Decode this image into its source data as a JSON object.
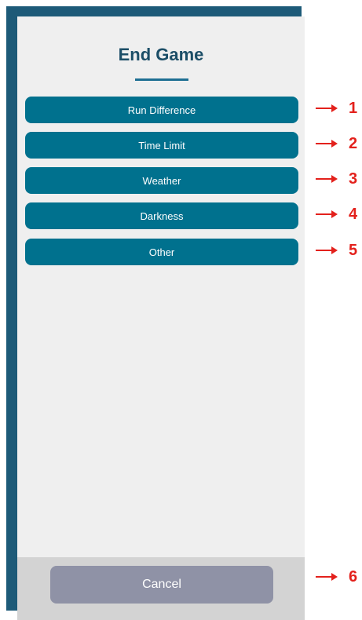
{
  "dialog": {
    "title": "End Game",
    "options": [
      {
        "label": "Run Difference"
      },
      {
        "label": "Time Limit"
      },
      {
        "label": "Weather"
      },
      {
        "label": "Darkness"
      },
      {
        "label": "Other"
      }
    ],
    "cancel_label": "Cancel"
  },
  "annotations": [
    "1",
    "2",
    "3",
    "4",
    "5",
    "6"
  ],
  "colors": {
    "frame": "#1d5a78",
    "screen_bg": "#efefef",
    "button": "#00718e",
    "title": "#1c4e67",
    "cancel_bg": "#8f92a6",
    "footer_bg": "#d3d3d3",
    "annotation": "#e3211c"
  }
}
